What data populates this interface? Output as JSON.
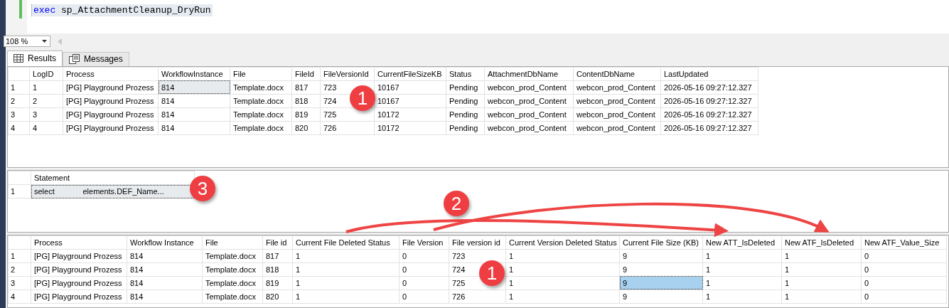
{
  "editor": {
    "keyword": "exec",
    "procedure": "sp_AttachmentCleanup_DryRun"
  },
  "zoom": {
    "value": "108 %"
  },
  "tabs": [
    {
      "label": "Results",
      "selected": true,
      "kind": "grid"
    },
    {
      "label": "Messages",
      "selected": false,
      "kind": "messages"
    }
  ],
  "grids": [
    {
      "focused": false,
      "columns": [
        "LogID",
        "Process",
        "WorkflowInstance",
        "File",
        "FileId",
        "FileVersionId",
        "CurrentFileSizeKB",
        "Status",
        "AttachmentDbName",
        "ContentDbName",
        "LastUpdated"
      ],
      "rows": [
        {
          "number": "1",
          "cells": [
            {
              "text": "1",
              "selected": false
            },
            {
              "text": "[PG] Playground Prozess",
              "selected": false
            },
            {
              "text": "814",
              "selected": true
            },
            {
              "text": "Template.docx",
              "selected": false
            },
            {
              "text": "817",
              "selected": false
            },
            {
              "text": "723",
              "selected": false
            },
            {
              "text": "10167",
              "selected": false
            },
            {
              "text": "Pending",
              "selected": false
            },
            {
              "text": "webcon_prod_Content",
              "selected": false
            },
            {
              "text": "webcon_prod_Content",
              "selected": false
            },
            {
              "text": "2026-05-16 09:27:12.327",
              "selected": false
            }
          ]
        },
        {
          "number": "2",
          "cells": [
            {
              "text": "2",
              "selected": false
            },
            {
              "text": "[PG] Playground Prozess",
              "selected": false
            },
            {
              "text": "814",
              "selected": false
            },
            {
              "text": "Template.docx",
              "selected": false
            },
            {
              "text": "818",
              "selected": false
            },
            {
              "text": "724",
              "selected": false
            },
            {
              "text": "10167",
              "selected": false
            },
            {
              "text": "Pending",
              "selected": false
            },
            {
              "text": "webcon_prod_Content",
              "selected": false
            },
            {
              "text": "webcon_prod_Content",
              "selected": false
            },
            {
              "text": "2026-05-16 09:27:12.327",
              "selected": false
            }
          ]
        },
        {
          "number": "3",
          "cells": [
            {
              "text": "3",
              "selected": false
            },
            {
              "text": "[PG] Playground Prozess",
              "selected": false
            },
            {
              "text": "814",
              "selected": false
            },
            {
              "text": "Template.docx",
              "selected": false
            },
            {
              "text": "819",
              "selected": false
            },
            {
              "text": "725",
              "selected": false
            },
            {
              "text": "10172",
              "selected": false
            },
            {
              "text": "Pending",
              "selected": false
            },
            {
              "text": "webcon_prod_Content",
              "selected": false
            },
            {
              "text": "webcon_prod_Content",
              "selected": false
            },
            {
              "text": "2026-05-16 09:27:12.327",
              "selected": false
            }
          ]
        },
        {
          "number": "4",
          "cells": [
            {
              "text": "4",
              "selected": false
            },
            {
              "text": "[PG] Playground Prozess",
              "selected": false
            },
            {
              "text": "814",
              "selected": false
            },
            {
              "text": "Template.docx",
              "selected": false
            },
            {
              "text": "820",
              "selected": false
            },
            {
              "text": "726",
              "selected": false
            },
            {
              "text": "10172",
              "selected": false
            },
            {
              "text": "Pending",
              "selected": false
            },
            {
              "text": "webcon_prod_Content",
              "selected": false
            },
            {
              "text": "webcon_prod_Content",
              "selected": false
            },
            {
              "text": "2026-05-16 09:27:12.327",
              "selected": false
            }
          ]
        }
      ]
    },
    {
      "focused": false,
      "columns": [
        "Statement"
      ],
      "rows": [
        {
          "number": "1",
          "cells": [
            {
              "text": "select             elements.DEF_Name...",
              "selected": true
            }
          ]
        }
      ]
    },
    {
      "focused": true,
      "columns": [
        "Process",
        "Workflow Instance",
        "File",
        "File id",
        "Current File Deleted Status",
        "File Version",
        "File version id",
        "Current Version Deleted Status",
        "Current File Size (KB)",
        "New ATT_IsDeleted",
        "New ATF_IsDeleted",
        "New ATF_Value_Size"
      ],
      "rows": [
        {
          "number": "1",
          "cells": [
            {
              "text": "[PG] Playground Prozess",
              "selected": false
            },
            {
              "text": "814",
              "selected": false
            },
            {
              "text": "Template.docx",
              "selected": false
            },
            {
              "text": "817",
              "selected": false
            },
            {
              "text": "1",
              "selected": false
            },
            {
              "text": "0",
              "selected": false
            },
            {
              "text": "723",
              "selected": false
            },
            {
              "text": "1",
              "selected": false
            },
            {
              "text": "9",
              "selected": false
            },
            {
              "text": "1",
              "selected": false
            },
            {
              "text": "1",
              "selected": false
            },
            {
              "text": "0",
              "selected": false
            }
          ]
        },
        {
          "number": "2",
          "cells": [
            {
              "text": "[PG] Playground Prozess",
              "selected": false
            },
            {
              "text": "814",
              "selected": false
            },
            {
              "text": "Template.docx",
              "selected": false
            },
            {
              "text": "818",
              "selected": false
            },
            {
              "text": "1",
              "selected": false
            },
            {
              "text": "0",
              "selected": false
            },
            {
              "text": "724",
              "selected": false
            },
            {
              "text": "1",
              "selected": false
            },
            {
              "text": "9",
              "selected": false
            },
            {
              "text": "1",
              "selected": false
            },
            {
              "text": "1",
              "selected": false
            },
            {
              "text": "0",
              "selected": false
            }
          ]
        },
        {
          "number": "3",
          "cells": [
            {
              "text": "[PG] Playground Prozess",
              "selected": false
            },
            {
              "text": "814",
              "selected": false
            },
            {
              "text": "Template.docx",
              "selected": false
            },
            {
              "text": "819",
              "selected": false
            },
            {
              "text": "1",
              "selected": false
            },
            {
              "text": "0",
              "selected": false
            },
            {
              "text": "725",
              "selected": false
            },
            {
              "text": "1",
              "selected": false
            },
            {
              "text": "9",
              "selected": true
            },
            {
              "text": "1",
              "selected": false
            },
            {
              "text": "1",
              "selected": false
            },
            {
              "text": "0",
              "selected": false
            }
          ]
        },
        {
          "number": "4",
          "cells": [
            {
              "text": "[PG] Playground Prozess",
              "selected": false
            },
            {
              "text": "814",
              "selected": false
            },
            {
              "text": "Template.docx",
              "selected": false
            },
            {
              "text": "820",
              "selected": false
            },
            {
              "text": "1",
              "selected": false
            },
            {
              "text": "0",
              "selected": false
            },
            {
              "text": "726",
              "selected": false
            },
            {
              "text": "1",
              "selected": false
            },
            {
              "text": "9",
              "selected": false
            },
            {
              "text": "1",
              "selected": false
            },
            {
              "text": "1",
              "selected": false
            },
            {
              "text": "0",
              "selected": false
            }
          ]
        }
      ]
    }
  ],
  "callouts": [
    {
      "text": "1"
    },
    {
      "text": "3"
    },
    {
      "text": "2"
    },
    {
      "text": "1"
    }
  ]
}
